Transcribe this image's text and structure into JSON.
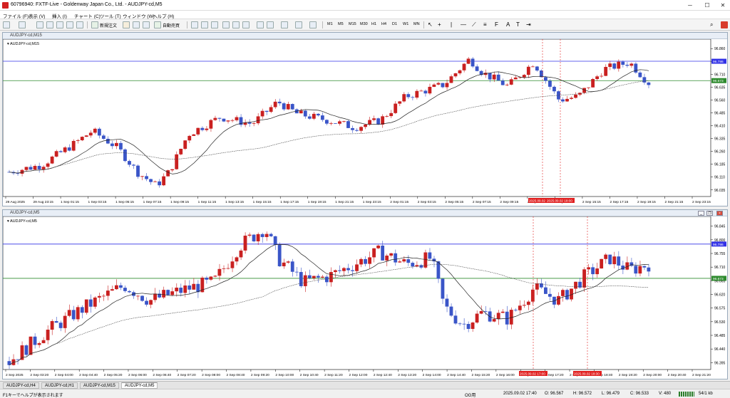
{
  "window": {
    "title": "60796940: FXTF-Live - Goldenway Japan Co., Ltd. - AUDJPY-cd,M5"
  },
  "menu": [
    "ファイル (F)",
    "表示 (V)",
    "挿入 (I)",
    "チャート (C)",
    "ツール (T)",
    "ウィンドウ (W)",
    "ヘルプ (H)"
  ],
  "toolbar": {
    "new_order": "新規注文",
    "auto_trade": "自動売買",
    "timeframes": [
      "M1",
      "M5",
      "M15",
      "M30",
      "H1",
      "H4",
      "D1",
      "W1",
      "MN"
    ]
  },
  "charts": [
    {
      "caption": "AUDJPY-cd,M15",
      "symbol_label": "AUDJPY-cd,M15",
      "price_ticks": [
        "96.860",
        "96.785",
        "96.710",
        "96.635",
        "96.560",
        "96.485",
        "96.410",
        "96.335",
        "96.260",
        "96.185",
        "96.110",
        "96.035"
      ],
      "time_ticks": [
        "29 Aug 2025",
        "29 Aug 23:15",
        "1 Sep 01:15",
        "1 Sep 03:15",
        "1 Sep 05:15",
        "1 Sep 07:15",
        "1 Sep 09:15",
        "1 Sep 11:15",
        "1 Sep 13:15",
        "1 Sep 15:15",
        "1 Sep 17:15",
        "1 Sep 19:15",
        "1 Sep 21:15",
        "1 Sep 23:15",
        "2 Sep 01:15",
        "2 Sep 03:15",
        "2 Sep 05:15",
        "2 Sep 07:15",
        "2 Sep 09:15",
        "2 Sep 11:15",
        "2 Sep 13:15",
        "2 Sep 15:15",
        "2 Sep 17:15",
        "2 Sep 19:15",
        "2 Sep 21:15",
        "2 Sep 23:15"
      ],
      "blue_level": "96.786",
      "green_level": "96.673",
      "vline_tags": [
        "2025.09.02 16:00",
        "2025.09.02 18:00"
      ]
    },
    {
      "caption": "AUDJPY-cd,M5",
      "symbol_label": "AUDJPY-cd,M5",
      "price_ticks": [
        "96.845",
        "96.800",
        "96.755",
        "96.710",
        "96.665",
        "96.620",
        "96.575",
        "96.530",
        "96.485",
        "96.440",
        "96.395"
      ],
      "time_ticks": [
        "2 Sep 2025",
        "2 Sep 03:20",
        "2 Sep 04:00",
        "2 Sep 04:40",
        "2 Sep 05:20",
        "2 Sep 06:00",
        "2 Sep 06:40",
        "2 Sep 07:20",
        "2 Sep 08:00",
        "2 Sep 08:40",
        "2 Sep 09:20",
        "2 Sep 10:00",
        "2 Sep 10:40",
        "2 Sep 11:20",
        "2 Sep 12:00",
        "2 Sep 12:40",
        "2 Sep 13:20",
        "2 Sep 14:00",
        "2 Sep 14:40",
        "2 Sep 15:20",
        "2 Sep 16:00",
        "2 Sep 16:40",
        "2 Sep 17:20",
        "2 Sep 18:00",
        "2 Sep 18:40",
        "2 Sep 19:20",
        "2 Sep 20:00",
        "2 Sep 20:40",
        "2 Sep 21:20"
      ],
      "blue_level": "96.786",
      "green_level": "96.673",
      "vline_tags": [
        "2025.09.02 17:00",
        "2025.09.02 18:30"
      ]
    }
  ],
  "tabs": [
    "AUDJPY-cd,H4",
    "AUDJPY-cd,H1",
    "AUDJPY-cd,M15",
    "AUDJPY-cd,M5"
  ],
  "status": {
    "help": "F1キーでヘルプが表示されます",
    "profile": "OG用",
    "time": "2025.09.02 17:40",
    "open": "O: 96.567",
    "high": "H: 96.572",
    "low": "L: 96.479",
    "close": "C: 96.533",
    "volume": "V: 480",
    "traffic": "54/1 kb"
  },
  "colors": {
    "bull": "#c92020",
    "bear": "#3a55c8",
    "blue_line": "#3232e6",
    "green_line": "#2e8b2e",
    "tag_red": "#e02020"
  }
}
